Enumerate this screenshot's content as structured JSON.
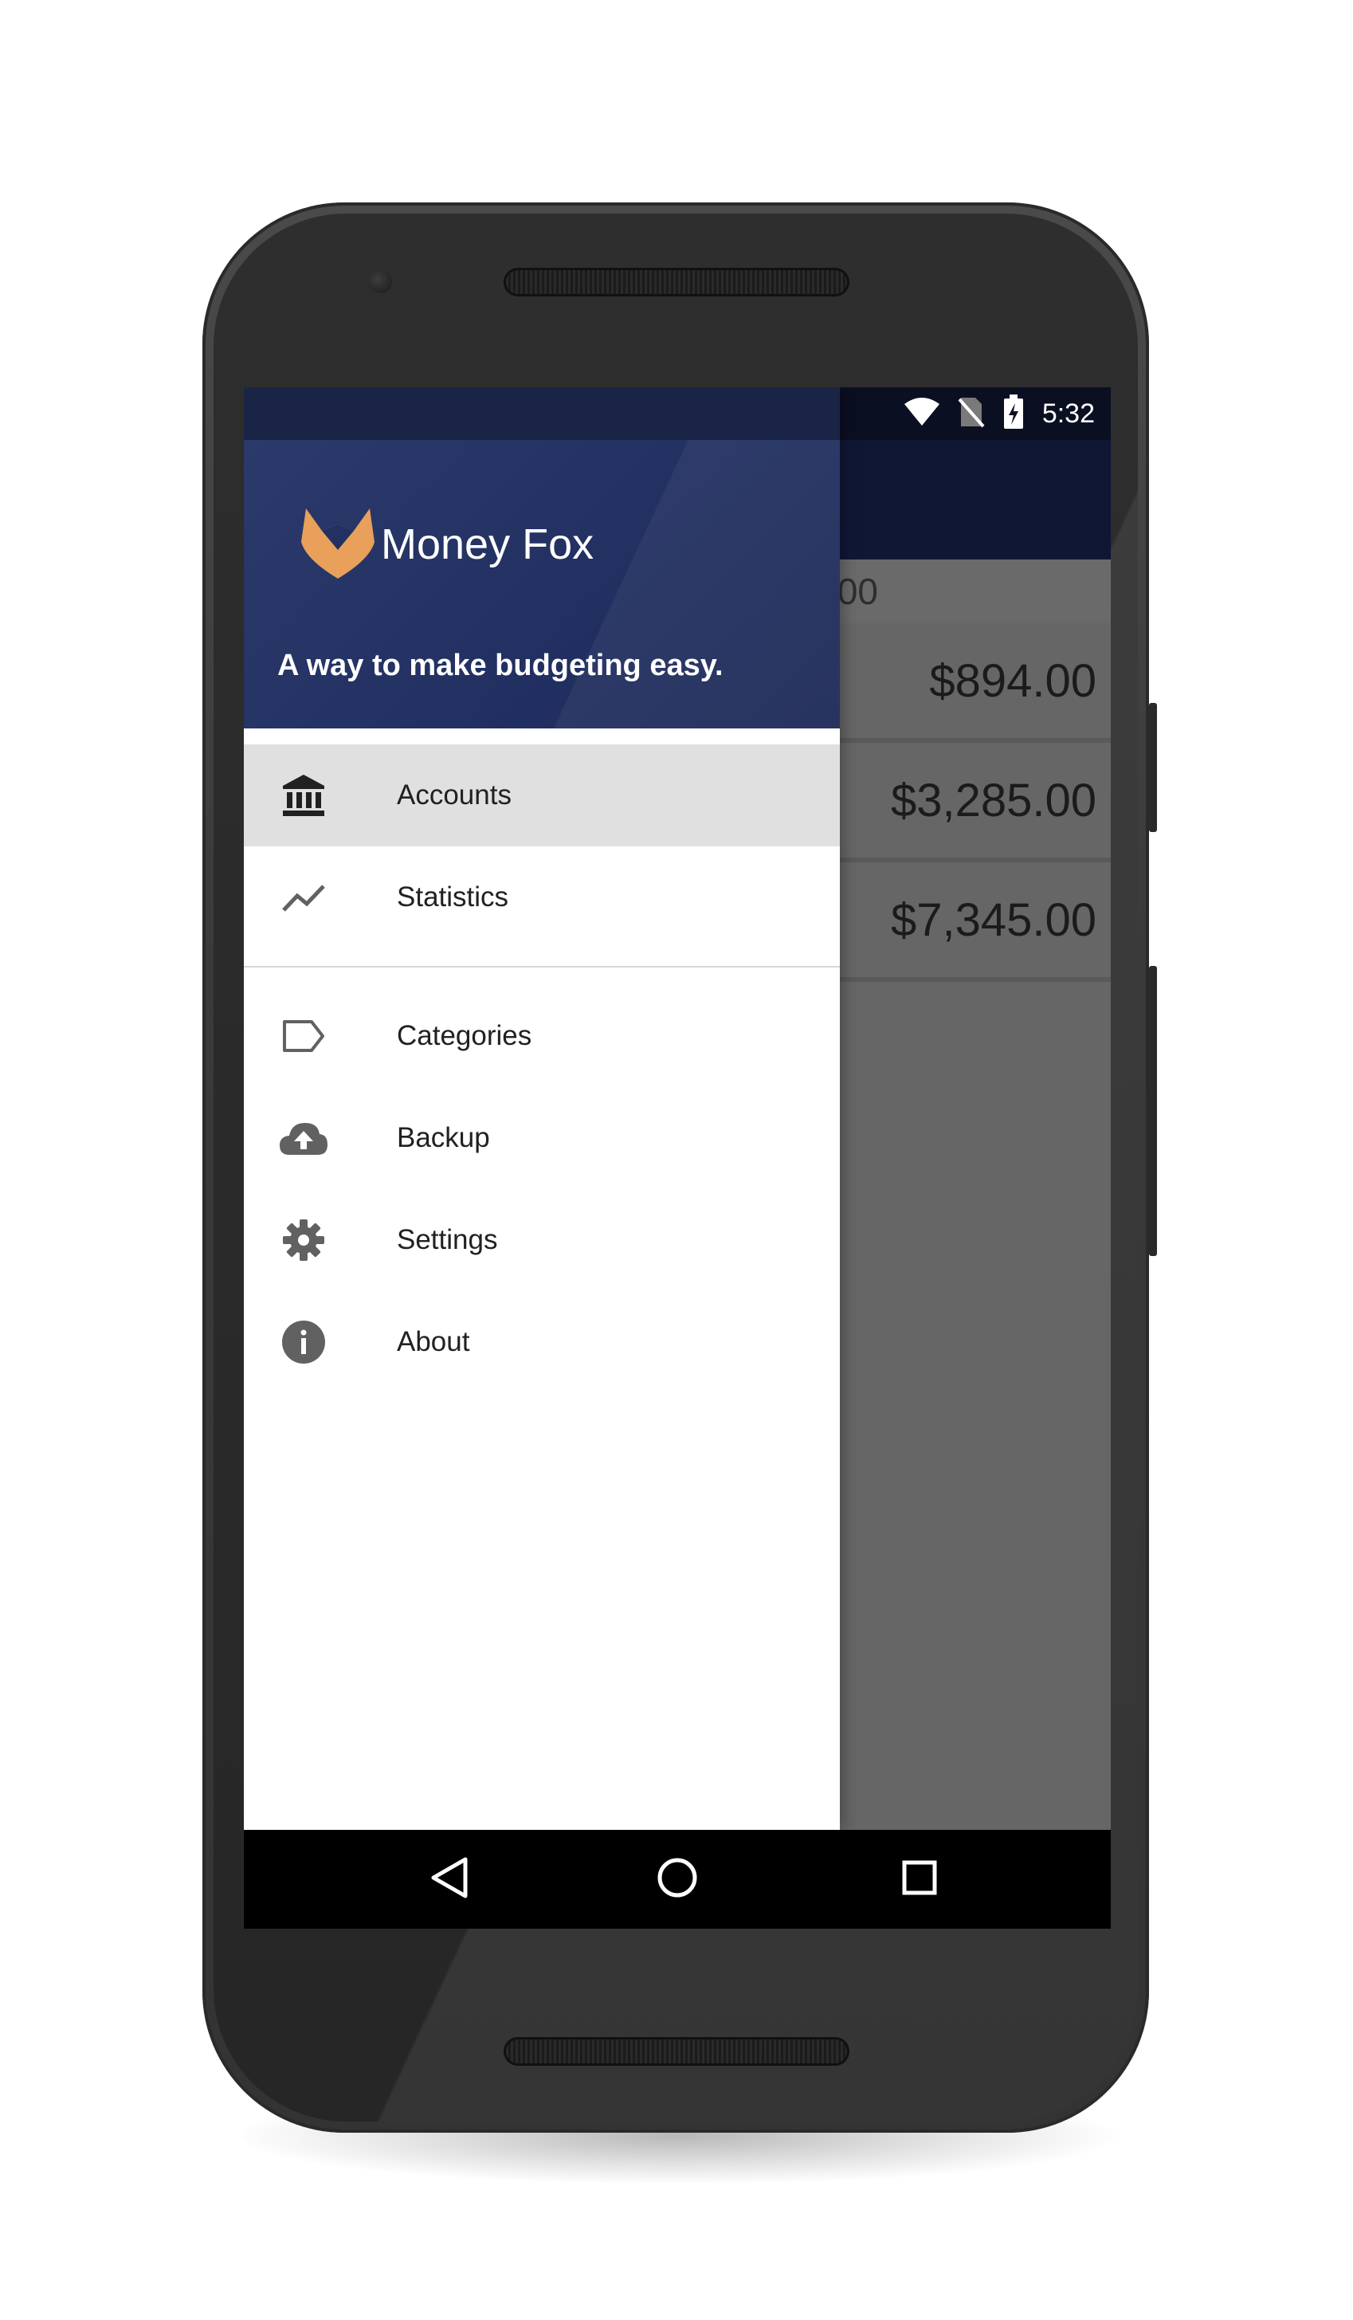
{
  "status_bar": {
    "time": "5:32",
    "icons": [
      "wifi-icon",
      "no-sim-icon",
      "battery-charging-icon"
    ]
  },
  "background_list": {
    "partial_header_text": "00",
    "rows": [
      "$894.00",
      "$3,285.00",
      "$7,345.00"
    ]
  },
  "drawer": {
    "app_name": "Money Fox",
    "tagline": "A way to make budgeting easy.",
    "logo_color": "#e8a05a",
    "header_color": "#223062",
    "primary_items": [
      {
        "label": "Accounts",
        "icon": "bank-icon",
        "active": true
      },
      {
        "label": "Statistics",
        "icon": "trending-up-icon",
        "active": false
      }
    ],
    "secondary_items": [
      {
        "label": "Categories",
        "icon": "label-icon"
      },
      {
        "label": "Backup",
        "icon": "cloud-upload-icon"
      },
      {
        "label": "Settings",
        "icon": "gear-icon"
      },
      {
        "label": "About",
        "icon": "info-icon"
      }
    ]
  },
  "nav_bar": {
    "buttons": [
      "back-icon",
      "home-icon",
      "recents-icon"
    ]
  }
}
